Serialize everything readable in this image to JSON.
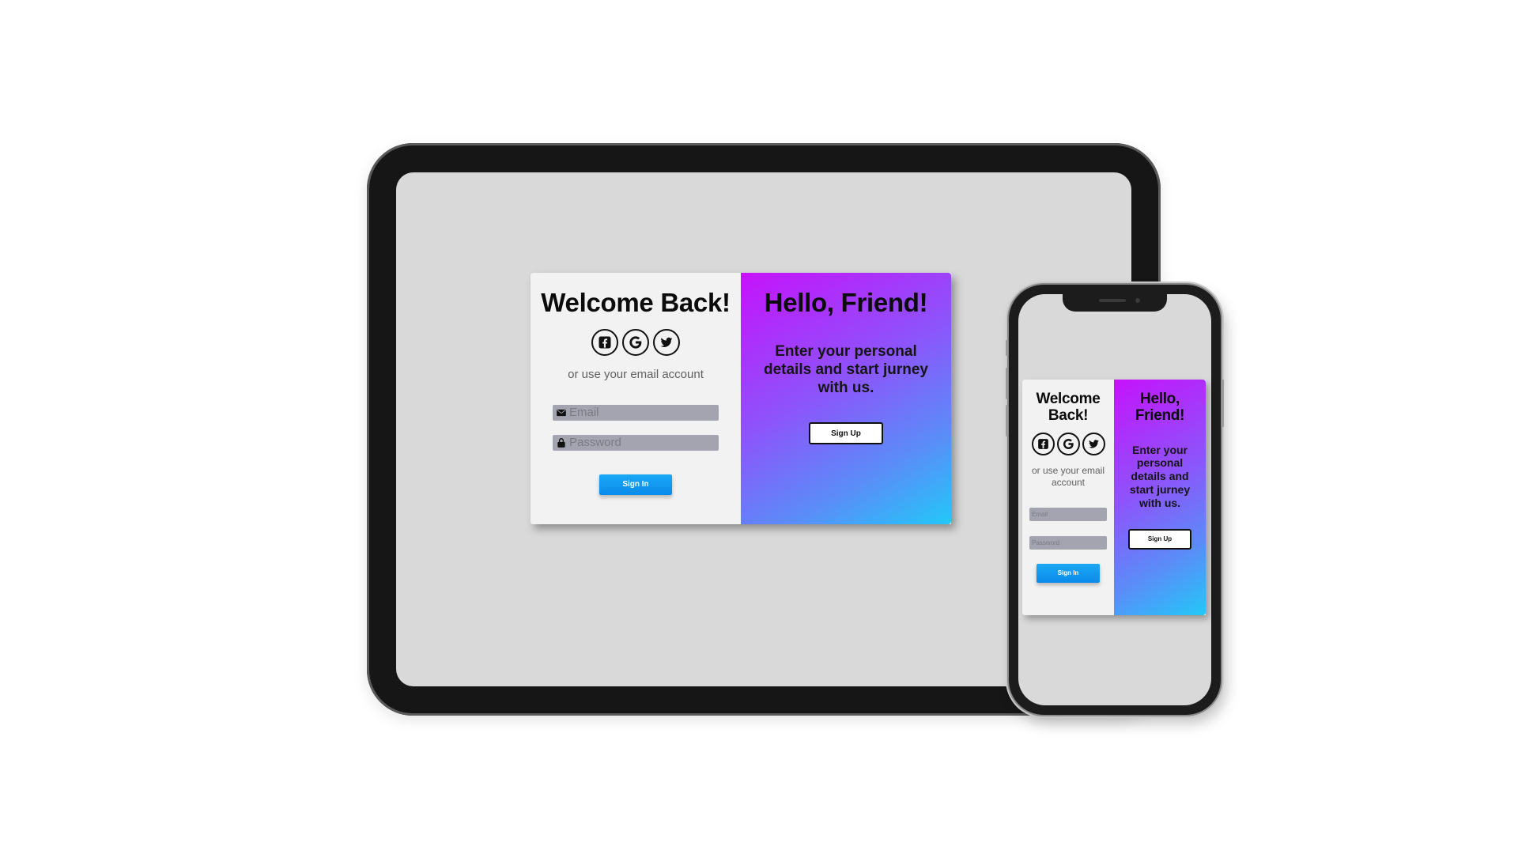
{
  "tablet": {
    "card": {
      "left": {
        "title": "Welcome Back!",
        "social_icons": [
          "facebook-icon",
          "google-icon",
          "twitter-icon"
        ],
        "subtext": "or use your email account",
        "email_placeholder": "Email",
        "password_placeholder": "Password",
        "sign_in_label": "Sign In"
      },
      "right": {
        "title": "Hello, Friend!",
        "message": "Enter your personal details and start jurney with us.",
        "sign_up_label": "Sign Up"
      }
    }
  },
  "phone": {
    "card": {
      "left": {
        "title": "Welcome Back!",
        "social_icons": [
          "facebook-icon",
          "google-icon",
          "twitter-icon"
        ],
        "subtext": "or use your email account",
        "email_placeholder": "Email",
        "password_placeholder": "Password",
        "sign_in_label": "Sign In"
      },
      "right": {
        "title": "Hello, Friend!",
        "message": "Enter your personal details and start jurney with us.",
        "sign_up_label": "Sign Up"
      }
    }
  },
  "colors": {
    "gradient_start": "#c612fb",
    "gradient_end": "#22c8f8",
    "primary_button": "#0a8bea",
    "input_fill": "#a4a4b0",
    "left_panel": "#f2f2f2"
  }
}
